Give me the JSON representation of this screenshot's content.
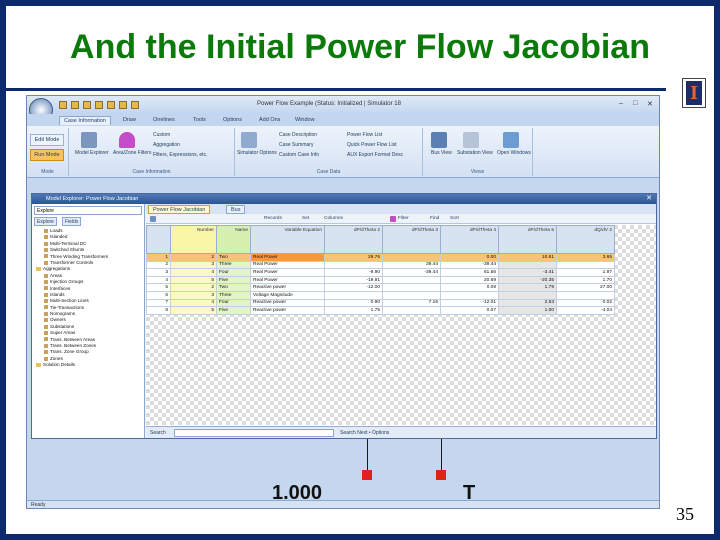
{
  "slide": {
    "title": "And the Initial Power Flow Jacobian",
    "page_number": "35",
    "logo_letter": "I"
  },
  "app": {
    "window_title": "Power Flow Example (Status: Initialized | Simulator 18",
    "ribbon_tabs": [
      "Case Information",
      "Draw",
      "Onelines",
      "Tools",
      "Options",
      "Add Ons",
      "Window"
    ],
    "active_tab": "Case Information",
    "mode": {
      "edit": "Edit Mode",
      "run": "Run Mode"
    },
    "ribbon_groups": {
      "mode": "Mode",
      "case_info": "Case Information",
      "case_data": "Case Data",
      "views": "Views"
    },
    "ribbon_buttons": {
      "model_explorer": "Model Explorer",
      "area_zone": "Area/Zone Filters",
      "custom": "Custom",
      "aggregation": "Aggregation",
      "filters": "Filters, Expressions, etc.",
      "simulator_options": "Simulator Options",
      "case_description": "Case Description",
      "case_summary": "Case Summary",
      "custom_case_info": "Custom Case Info",
      "power_flow_list": "Power Flow List",
      "quick_power_flow_list": "Quick Power Flow List",
      "aux_export": "AUX Export Format Desc",
      "bus_view": "Bus View",
      "substation_view": "Substation View",
      "open_windows": "Open Windows"
    },
    "status_text": "Ready"
  },
  "explorer": {
    "title": "Model Explorer: Power Flow Jacobian",
    "left_combo": "Explore",
    "left_tabs": [
      "Explore",
      "Fields"
    ],
    "tree": [
      "Loads",
      "Islanded",
      "Multi-Terminal DC",
      "Switched Shunts",
      "Three Winding Transformers",
      "Transformer Controls",
      "Aggregations",
      "Areas",
      "Injection Groups",
      "Interfaces",
      "Islands",
      "Multi-Section Lines",
      "Tie-Transactions",
      "Nomograms",
      "Owners",
      "Substations",
      "Super Areas",
      "Trans. Between Areas",
      "Trans. Between Zones",
      "Trans. Zone Group",
      "Zones",
      "Solution Details"
    ],
    "doc_tabs": [
      "Power Flow Jacobian",
      "Bus"
    ],
    "active_doc_tab": "Power Flow Jacobian",
    "toolbar": [
      "Records",
      "Set",
      "Columns",
      "Filter",
      "Find",
      "Sort"
    ],
    "search": {
      "label": "Search",
      "next": "Search Next",
      "options": "Options"
    }
  },
  "jacobian": {
    "columns": [
      "Number",
      "Name",
      "Variable Equation",
      "dP/dTheta 2",
      "dP/dTheta 3",
      "dP/dTheta 4",
      "dP/dTheta 5",
      "dQ/dV 2",
      "dQ/dV 4"
    ],
    "rows": [
      {
        "row": "1",
        "number": "2",
        "name": "Two",
        "eq": "Real Power",
        "c1": "29.76",
        "c2": "",
        "c3": "0.00",
        "c4": "10.81",
        "c5": "3.65"
      },
      {
        "row": "2",
        "number": "3",
        "name": "Three",
        "eq": "Real Power",
        "c1": "",
        "c2": "39.44",
        "c3": "-39.44",
        "c4": "",
        "c5": ""
      },
      {
        "row": "3",
        "number": "4",
        "name": "Four",
        "eq": "Real Power",
        "c1": "-9.90",
        "c2": "-39.44",
        "c3": "61.56",
        "c4": "-3.41",
        "c5": "1.97"
      },
      {
        "row": "4",
        "number": "5",
        "name": "Five",
        "eq": "Real Power",
        "c1": "-19.91",
        "c2": "",
        "c3": "20.69",
        "c4": "-20.35",
        "c5": "1.70"
      },
      {
        "row": "5",
        "number": "2",
        "name": "Two",
        "eq": "Reactive power",
        "c1": "-12.00",
        "c2": "",
        "c3": "0.09",
        "c4": "1.79",
        "c5": "27.00"
      },
      {
        "row": "6",
        "number": "3",
        "name": "Three",
        "eq": "Voltage Magnitude",
        "c1": "",
        "c2": "",
        "c3": "",
        "c4": "",
        "c5": ""
      },
      {
        "row": "7",
        "number": "4",
        "name": "Four",
        "eq": "Reactive power",
        "c1": "0.90",
        "c2": "7.16",
        "c3": "-12.01",
        "c4": "2.53",
        "c5": "0.02"
      },
      {
        "row": "8",
        "number": "5",
        "name": "Five",
        "eq": "Reactive power",
        "c1": "1.75",
        "c2": "",
        "c3": "0.07",
        "c4": "1.00",
        "c5": "-4.04"
      }
    ]
  },
  "oneline": {
    "value_text": "1.000",
    "label_text": "T"
  }
}
